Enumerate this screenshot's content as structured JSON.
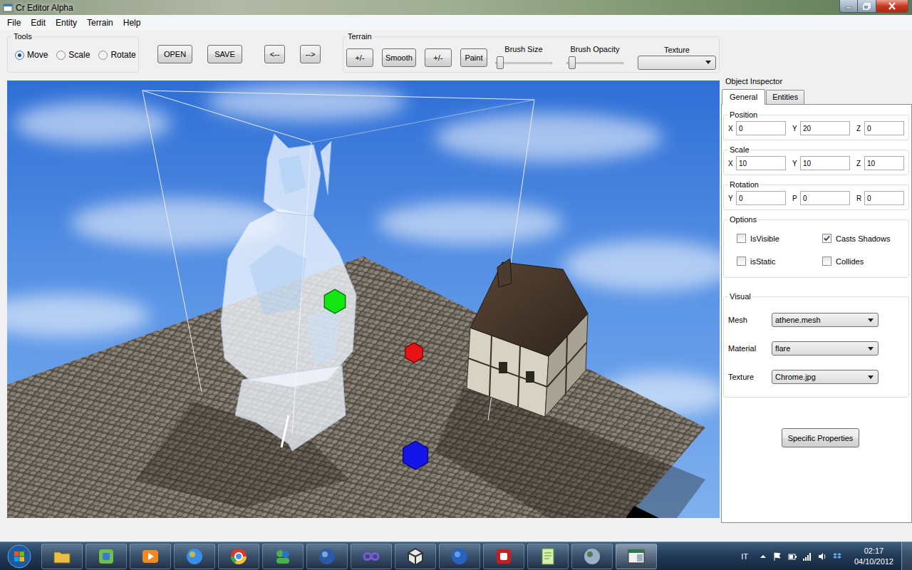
{
  "window": {
    "title": "Cr Editor Alpha"
  },
  "menu": [
    "File",
    "Edit",
    "Entity",
    "Terrain",
    "Help"
  ],
  "tools": {
    "label": "Tools",
    "options": [
      {
        "label": "Move",
        "selected": true
      },
      {
        "label": "Scale",
        "selected": false
      },
      {
        "label": "Rotate",
        "selected": false
      }
    ]
  },
  "file_buttons": [
    "OPEN",
    "SAVE",
    "<--",
    "-->"
  ],
  "terrain": {
    "label": "Terrain",
    "buttons": [
      "+/-",
      "Smooth",
      "+/-",
      "Paint"
    ],
    "sliders": [
      {
        "label": "Brush Size",
        "level": 0.03
      },
      {
        "label": "Brush Opacity",
        "level": 0.05
      }
    ],
    "texture": {
      "label": "Texture",
      "value": ""
    }
  },
  "viewport": {
    "gizmo": [
      {
        "color": "#14e614"
      },
      {
        "color": "#e61414"
      },
      {
        "color": "#1414e6"
      }
    ]
  },
  "inspector": {
    "title": "Object Inspector",
    "tabs": [
      {
        "label": "General",
        "selected": true
      },
      {
        "label": "Entities",
        "selected": false
      }
    ],
    "vectors": [
      {
        "label": "Position",
        "fields": [
          {
            "label": "X",
            "value": "0"
          },
          {
            "label": "Y",
            "value": "20"
          },
          {
            "label": "Z",
            "value": "0"
          }
        ]
      },
      {
        "label": "Scale",
        "fields": [
          {
            "label": "X",
            "value": "10"
          },
          {
            "label": "Y",
            "value": "10"
          },
          {
            "label": "Z",
            "value": "10"
          }
        ]
      },
      {
        "label": "Rotation",
        "fields": [
          {
            "label": "Y",
            "value": "0"
          },
          {
            "label": "P",
            "value": "0"
          },
          {
            "label": "R",
            "value": "0"
          }
        ]
      }
    ],
    "options": {
      "label": "Options",
      "items": [
        {
          "label": "IsVisible",
          "checked": false
        },
        {
          "label": "Casts Shadows",
          "checked": true
        },
        {
          "label": "isStatic",
          "checked": false
        },
        {
          "label": "Collides",
          "checked": false
        }
      ]
    },
    "visual": {
      "label": "Visual",
      "fields": [
        {
          "label": "Mesh",
          "value": "athene.mesh"
        },
        {
          "label": "Material",
          "value": "flare"
        },
        {
          "label": "Texture",
          "value": "Chrome.jpg"
        }
      ]
    },
    "button": "Specific Properties"
  },
  "taskbar": {
    "tray": {
      "language": "IT",
      "time": "02:17",
      "date": "04/10/2012"
    }
  }
}
